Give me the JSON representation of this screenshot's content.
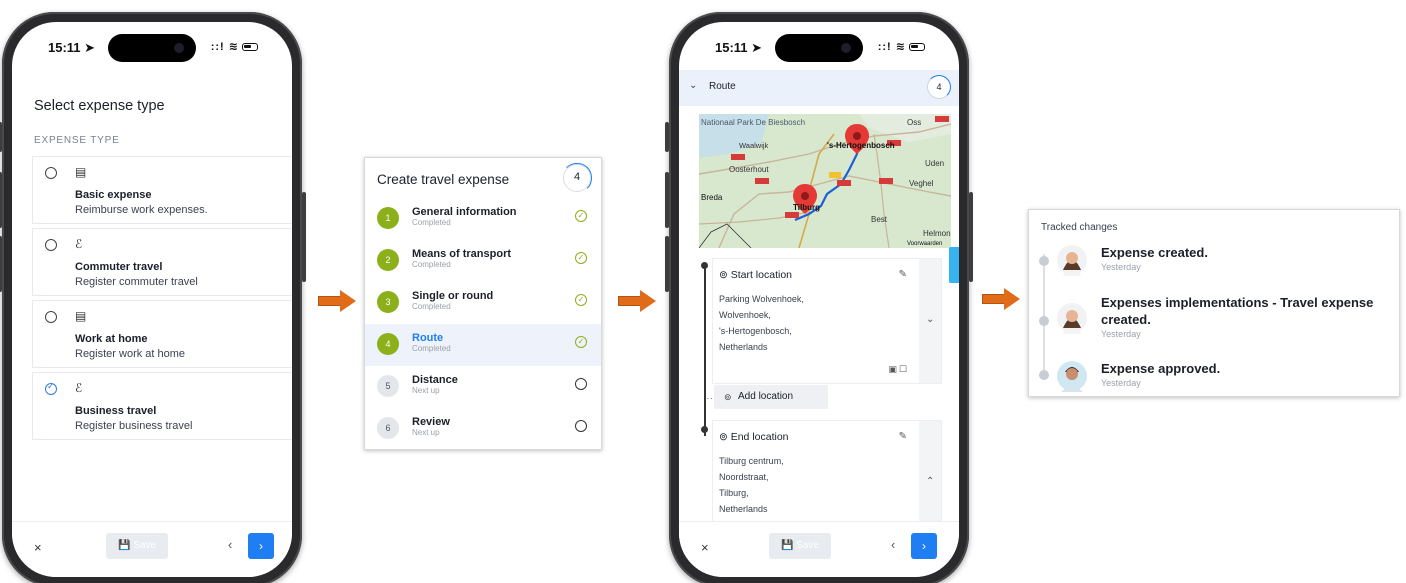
{
  "status_bar": {
    "time": "15:11 ➤",
    "icons": "::! ≋"
  },
  "expense_type_screen": {
    "title": "Select expense type",
    "section_label": "EXPENSE TYPE",
    "options": [
      {
        "icon": "document-icon",
        "label": "Basic expense",
        "description": "Reimburse work expenses.",
        "selected": false
      },
      {
        "icon": "commute-route-icon",
        "label": "Commuter travel",
        "description": "Register commuter travel",
        "selected": false
      },
      {
        "icon": "document-icon",
        "label": "Work at home",
        "description": "Register work at home",
        "selected": false
      },
      {
        "icon": "commute-route-icon",
        "label": "Business travel",
        "description": "Register business travel",
        "selected": true
      }
    ],
    "footer": {
      "close": "×",
      "save": "Save",
      "prev": "‹",
      "next": "›"
    }
  },
  "travel_expense_card": {
    "title": "Create travel expense",
    "step_count": "4",
    "steps": [
      {
        "number": "1",
        "name": "General information",
        "status": "Completed",
        "done": true
      },
      {
        "number": "2",
        "name": "Means of transport",
        "status": "Completed",
        "done": true
      },
      {
        "number": "3",
        "name": "Single or round",
        "status": "Completed",
        "done": true
      },
      {
        "number": "4",
        "name": "Route",
        "status": "Completed",
        "done": true,
        "active": true
      },
      {
        "number": "5",
        "name": "Distance",
        "status": "Next up",
        "done": false
      },
      {
        "number": "6",
        "name": "Review",
        "status": "Next up",
        "done": false
      }
    ]
  },
  "route_screen": {
    "header": {
      "label": "Route",
      "count": "4"
    },
    "map": {
      "labels": [
        "Nationaal Park De Biesbosch",
        "Waalwijk",
        "'s-Hertogenbosch",
        "Oss",
        "Oosterhout",
        "Uden",
        "Veghel",
        "Breda",
        "Tilburg",
        "Best",
        "Helmond",
        "Voorwaarden"
      ]
    },
    "start_location": {
      "title": "Start location",
      "address": [
        "Parking Wolvenhoek,",
        "Wolvenhoek,",
        "'s-Hertogenbosch,",
        "Netherlands"
      ]
    },
    "add_location": "Add location",
    "end_location": {
      "title": "End location",
      "address": [
        "Tilburg centrum,",
        "Noordstraat,",
        "Tilburg,",
        "Netherlands"
      ]
    },
    "footer": {
      "close": "×",
      "save": "Save",
      "prev": "‹",
      "next": "›"
    }
  },
  "tracked_changes": {
    "title": "Tracked changes",
    "items": [
      {
        "text": "Expense created.",
        "time": "Yesterday"
      },
      {
        "text": "Expenses implementations - Travel expense created.",
        "time": "Yesterday"
      },
      {
        "text": "Expense approved.",
        "time": "Yesterday"
      }
    ]
  },
  "colors": {
    "accent": "#1f7ff2",
    "step_done": "#8bb01a",
    "arrow": "#e06c1a",
    "pin": "#e53935"
  }
}
